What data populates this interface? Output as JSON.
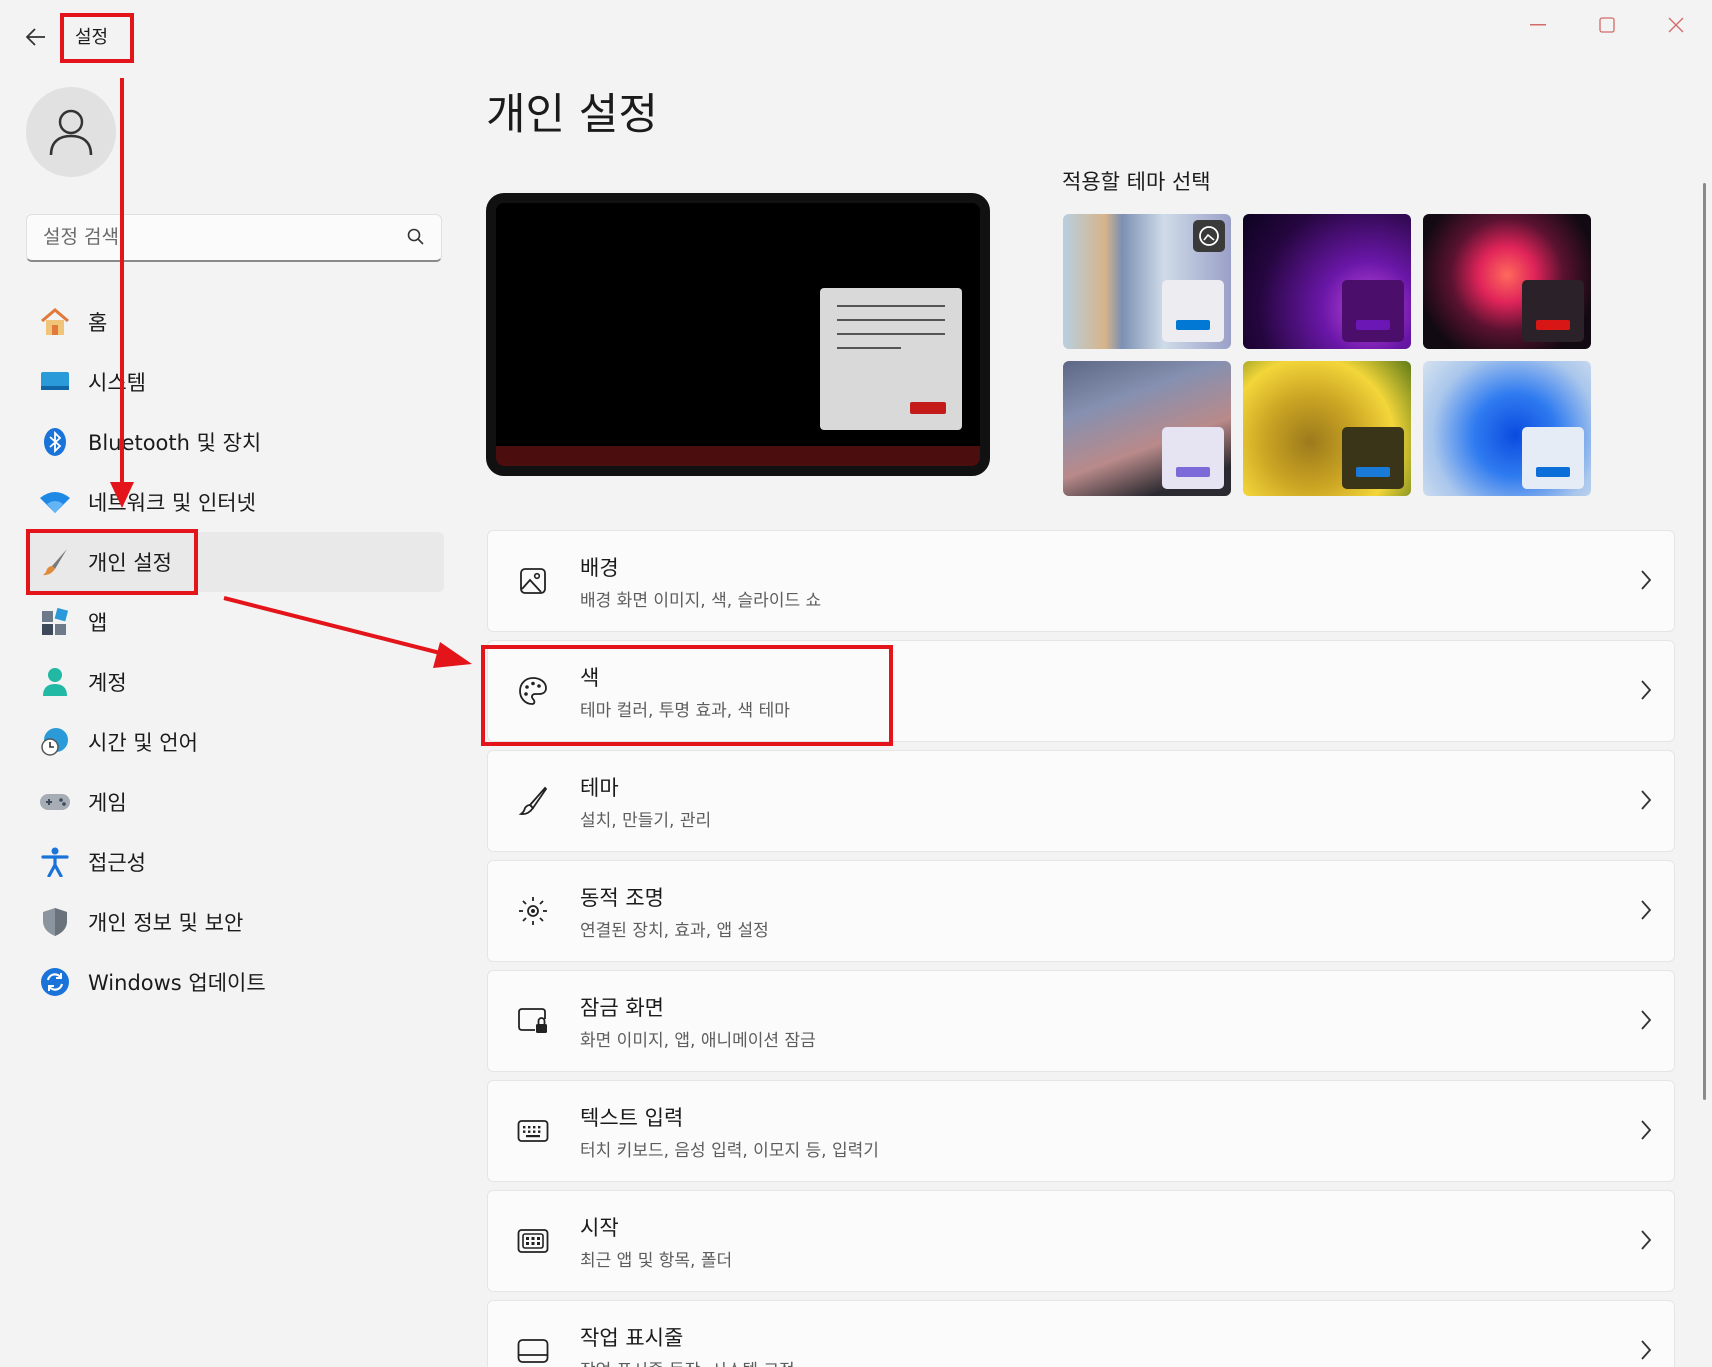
{
  "window": {
    "title": "설정",
    "controls": [
      "minimize",
      "maximize",
      "close"
    ]
  },
  "sidebar": {
    "search": {
      "placeholder": "설정 검색",
      "value": ""
    },
    "items": [
      {
        "label": "홈",
        "icon": "home-icon"
      },
      {
        "label": "시스템",
        "icon": "system-icon"
      },
      {
        "label": "Bluetooth 및 장치",
        "icon": "bluetooth-icon"
      },
      {
        "label": "네트워크 및 인터넷",
        "icon": "wifi-icon"
      },
      {
        "label": "개인 설정",
        "icon": "brush-icon",
        "selected": true
      },
      {
        "label": "앱",
        "icon": "apps-icon"
      },
      {
        "label": "계정",
        "icon": "account-icon"
      },
      {
        "label": "시간 및 언어",
        "icon": "globe-clock-icon"
      },
      {
        "label": "게임",
        "icon": "gamepad-icon"
      },
      {
        "label": "접근성",
        "icon": "accessibility-icon"
      },
      {
        "label": "개인 정보 및 보안",
        "icon": "shield-icon"
      },
      {
        "label": "Windows 업데이트",
        "icon": "update-icon"
      }
    ]
  },
  "main": {
    "title": "개인 설정",
    "theme_header": "적용할 테마 선택",
    "cards": [
      {
        "title": "배경",
        "subtitle": "배경 화면 이미지, 색, 슬라이드 쇼",
        "icon": "image-icon"
      },
      {
        "title": "색",
        "subtitle": "테마 컬러, 투명 효과, 색 테마",
        "icon": "palette-icon"
      },
      {
        "title": "테마",
        "subtitle": "설치, 만들기, 관리",
        "icon": "brush-icon"
      },
      {
        "title": "동적 조명",
        "subtitle": "연결된 장치, 효과, 앱 설정",
        "icon": "dynamic-lighting-icon"
      },
      {
        "title": "잠금 화면",
        "subtitle": "화면 이미지, 앱, 애니메이션 잠금",
        "icon": "lock-screen-icon"
      },
      {
        "title": "텍스트 입력",
        "subtitle": "터치 키보드, 음성 입력, 이모지 등, 입력기",
        "icon": "keyboard-icon"
      },
      {
        "title": "시작",
        "subtitle": "최근 앱 및 항목, 폴더",
        "icon": "start-icon"
      },
      {
        "title": "작업 표시줄",
        "subtitle": "작업 표시줄 동작, 시스템 고정",
        "icon": "taskbar-icon"
      }
    ]
  },
  "colors": {
    "annotation": "#e3141a",
    "accent_blue": "#0067c0",
    "preview_taskbar": "#4b0d0d"
  }
}
